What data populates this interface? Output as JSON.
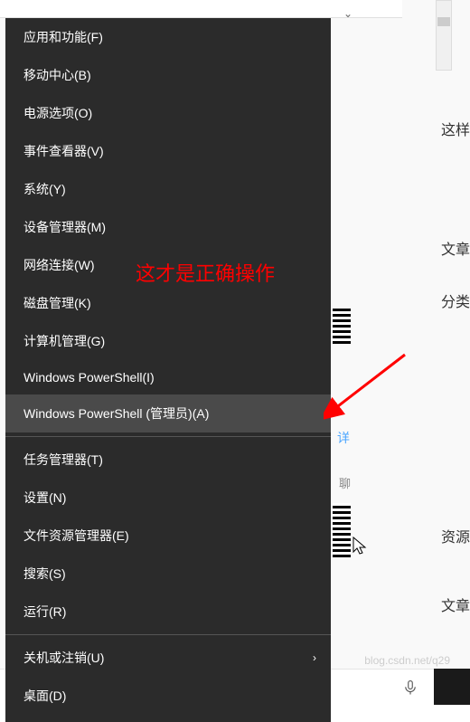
{
  "menu": {
    "items": [
      {
        "label": "应用和功能(F)",
        "highlighted": false,
        "hasSubmenu": false
      },
      {
        "label": "移动中心(B)",
        "highlighted": false,
        "hasSubmenu": false
      },
      {
        "label": "电源选项(O)",
        "highlighted": false,
        "hasSubmenu": false
      },
      {
        "label": "事件查看器(V)",
        "highlighted": false,
        "hasSubmenu": false
      },
      {
        "label": "系统(Y)",
        "highlighted": false,
        "hasSubmenu": false
      },
      {
        "label": "设备管理器(M)",
        "highlighted": false,
        "hasSubmenu": false
      },
      {
        "label": "网络连接(W)",
        "highlighted": false,
        "hasSubmenu": false
      },
      {
        "label": "磁盘管理(K)",
        "highlighted": false,
        "hasSubmenu": false
      },
      {
        "label": "计算机管理(G)",
        "highlighted": false,
        "hasSubmenu": false
      },
      {
        "label": "Windows PowerShell(I)",
        "highlighted": false,
        "hasSubmenu": false
      },
      {
        "label": "Windows PowerShell (管理员)(A)",
        "highlighted": true,
        "hasSubmenu": false
      },
      {
        "separator": true
      },
      {
        "label": "任务管理器(T)",
        "highlighted": false,
        "hasSubmenu": false
      },
      {
        "label": "设置(N)",
        "highlighted": false,
        "hasSubmenu": false
      },
      {
        "label": "文件资源管理器(E)",
        "highlighted": false,
        "hasSubmenu": false
      },
      {
        "label": "搜索(S)",
        "highlighted": false,
        "hasSubmenu": false
      },
      {
        "label": "运行(R)",
        "highlighted": false,
        "hasSubmenu": false
      },
      {
        "separator": true
      },
      {
        "label": "关机或注销(U)",
        "highlighted": false,
        "hasSubmenu": true
      },
      {
        "label": "桌面(D)",
        "highlighted": false,
        "hasSubmenu": false
      }
    ]
  },
  "annotation": {
    "text": "这才是正确操作"
  },
  "background": {
    "text1": "这样",
    "text2": "文章",
    "text3": "分类",
    "text4": "聊",
    "text5": "资源",
    "text6": "文章",
    "link": "详"
  },
  "watermark": "blog.csdn.net/q29"
}
